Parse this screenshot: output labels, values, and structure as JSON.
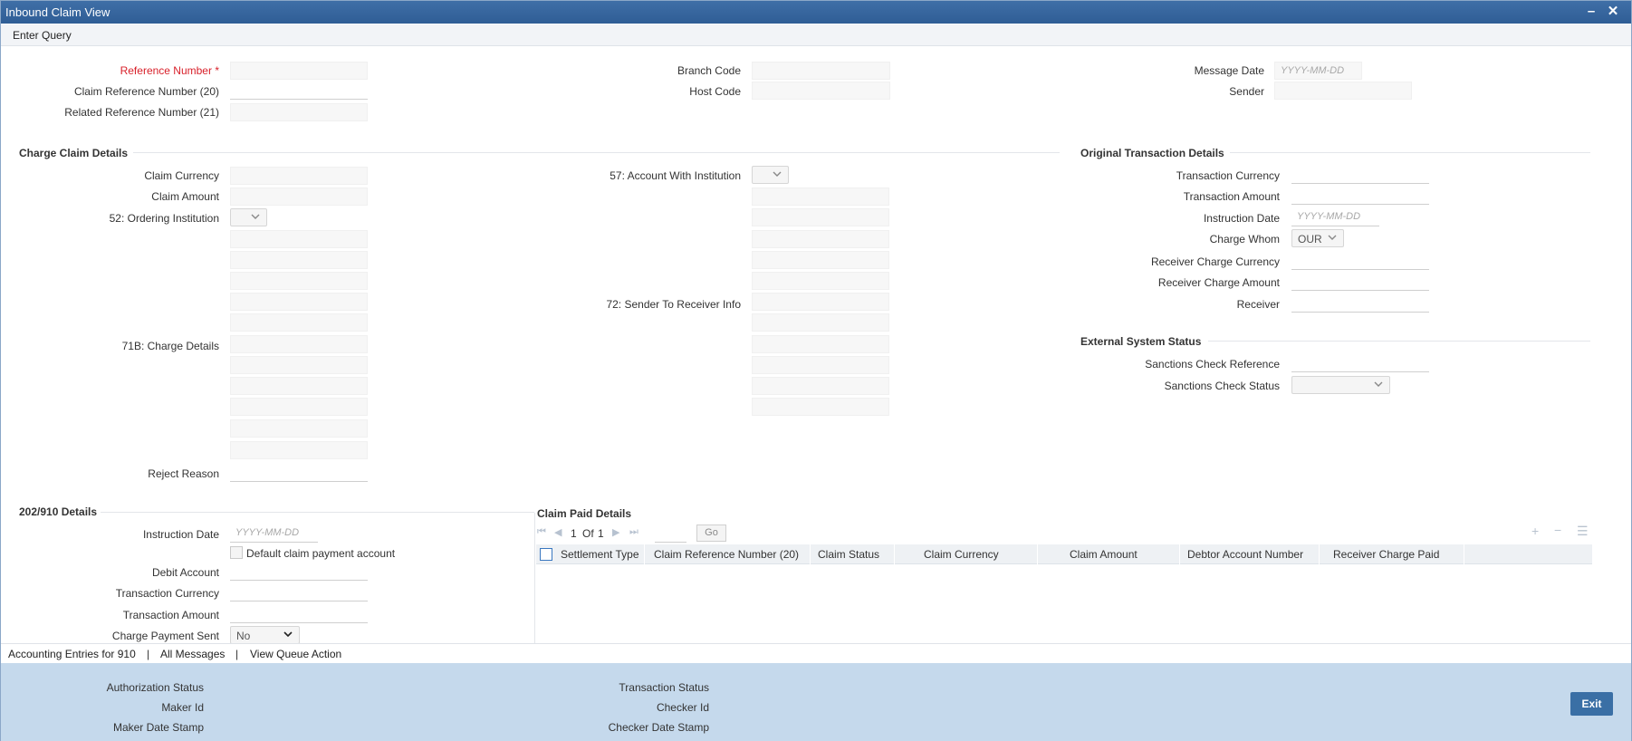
{
  "window": {
    "title": "Inbound Claim View",
    "minimize_icon": "minus-icon",
    "close_icon": "close-icon"
  },
  "menu": {
    "enter_query": "Enter Query"
  },
  "header_fields": {
    "reference_number": {
      "label": "Reference Number",
      "required_mark": "*",
      "value": ""
    },
    "claim_reference_number": {
      "label": "Claim Reference Number (20)",
      "value": ""
    },
    "related_reference_number": {
      "label": "Related Reference Number (21)",
      "value": ""
    },
    "branch_code": {
      "label": "Branch Code",
      "value": ""
    },
    "host_code": {
      "label": "Host Code",
      "value": ""
    },
    "message_date": {
      "label": "Message Date",
      "placeholder": "YYYY-MM-DD",
      "value": ""
    },
    "sender": {
      "label": "Sender",
      "value": ""
    }
  },
  "charge_claim": {
    "title": "Charge Claim Details",
    "claim_currency": {
      "label": "Claim Currency",
      "value": ""
    },
    "claim_amount": {
      "label": "Claim Amount",
      "value": ""
    },
    "ordering_institution": {
      "label": "52: Ordering Institution",
      "value": ""
    },
    "charge_details": {
      "label": "71B: Charge Details",
      "value": ""
    },
    "reject_reason": {
      "label": "Reject Reason",
      "value": ""
    },
    "account_with_institution": {
      "label": "57: Account With Institution",
      "value": ""
    },
    "sender_to_receiver_info": {
      "label": "72: Sender To Receiver Info",
      "value": ""
    }
  },
  "original_transaction": {
    "title": "Original Transaction Details",
    "transaction_currency": {
      "label": "Transaction Currency",
      "value": ""
    },
    "transaction_amount": {
      "label": "Transaction Amount",
      "value": ""
    },
    "instruction_date": {
      "label": "Instruction Date",
      "placeholder": "YYYY-MM-DD",
      "value": ""
    },
    "charge_whom": {
      "label": "Charge Whom",
      "value": "OUR"
    },
    "receiver_charge_currency": {
      "label": "Receiver Charge Currency",
      "value": ""
    },
    "receiver_charge_amount": {
      "label": "Receiver Charge Amount",
      "value": ""
    },
    "receiver": {
      "label": "Receiver",
      "value": ""
    }
  },
  "external_system": {
    "title": "External System Status",
    "sanctions_check_reference": {
      "label": "Sanctions Check Reference",
      "value": ""
    },
    "sanctions_check_status": {
      "label": "Sanctions Check Status",
      "value": ""
    }
  },
  "details_202_910": {
    "title": "202/910 Details",
    "instruction_date": {
      "label": "Instruction Date",
      "placeholder": "YYYY-MM-DD",
      "value": ""
    },
    "default_claim_payment_account": {
      "label": "Default claim payment account",
      "checked": false
    },
    "debit_account": {
      "label": "Debit Account",
      "value": ""
    },
    "transaction_currency": {
      "label": "Transaction Currency",
      "value": ""
    },
    "transaction_amount": {
      "label": "Transaction Amount",
      "value": ""
    },
    "charge_payment_sent": {
      "label": "Charge Payment Sent",
      "value": "No"
    }
  },
  "claim_paid": {
    "title": "Claim Paid Details",
    "pager": {
      "current": "1",
      "of_label": "Of",
      "total": "1",
      "go_label": "Go"
    },
    "columns": [
      "Settlement Type",
      "Claim Reference Number (20)",
      "Claim Status",
      "Claim Currency",
      "Claim Amount",
      "Debtor Account Number",
      "Receiver Charge Paid"
    ],
    "rows": []
  },
  "links": {
    "accounting_entries": "Accounting Entries for 910",
    "separator": "|",
    "all_messages": "All Messages",
    "view_queue_action": "View Queue Action"
  },
  "footer": {
    "authorization_status": "Authorization Status",
    "maker_id": "Maker Id",
    "maker_date_stamp": "Maker Date Stamp",
    "transaction_status": "Transaction Status",
    "checker_id": "Checker Id",
    "checker_date_stamp": "Checker Date Stamp",
    "exit_label": "Exit"
  },
  "colors": {
    "titlebar": "#2f5d95",
    "footer": "#c5d9ec",
    "exit_button": "#3a6fa5",
    "required": "#d8202a"
  }
}
